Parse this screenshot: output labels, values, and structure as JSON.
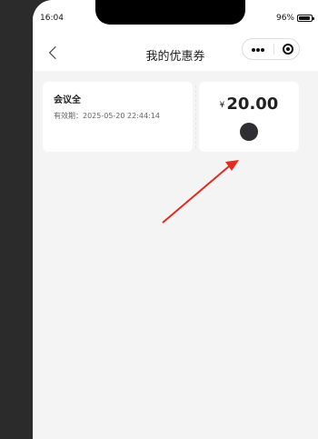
{
  "status_bar": {
    "time": "16:04",
    "battery": "96%"
  },
  "navbar": {
    "title": "我的优惠券"
  },
  "coupon": {
    "name": "会议全",
    "validity": "有效期：2025-05-20 22:44:14",
    "currency_symbol": "¥",
    "amount": "20.00"
  },
  "colors": {
    "page_background": "#f4f4f4",
    "card_background": "#ffffff",
    "annotation_arrow": "#e32b1f",
    "dot": "#2f2f33"
  }
}
